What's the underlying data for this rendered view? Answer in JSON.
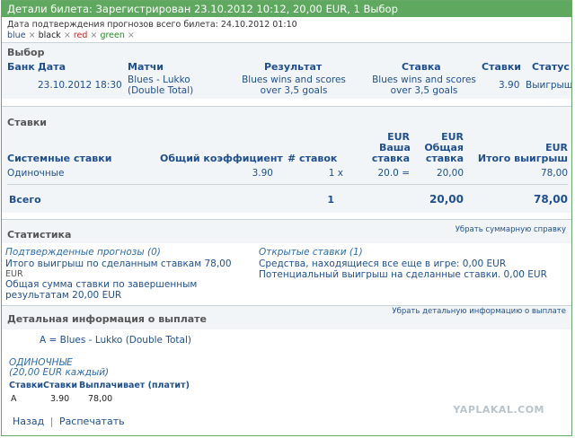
{
  "title": "Детали билета: Зарегистрирован 23.10.2012 10:12, 20,00 EUR, 1 Выбор",
  "confirm_date": "Дата подтверждения прогнозов всего билета: 24.10.2012 01:10",
  "colors": [
    {
      "label": "blue",
      "color": "#1f4f8f"
    },
    {
      "label": "black",
      "color": "#222222"
    },
    {
      "label": "red",
      "color": "#cc2222"
    },
    {
      "label": "green",
      "color": "#2a8a2a"
    }
  ],
  "x": "×",
  "selection": {
    "heading": "Выбор",
    "cols": {
      "bank": "Банк",
      "date": "Дата",
      "match": "Матчи",
      "result": "Результат",
      "bet": "Ставка",
      "stakes": "Ставки",
      "status": "Статус"
    },
    "row": {
      "date": "23.10.2012 18:30",
      "match_line1": "Blues - Lukko",
      "match_line2": "(Double Total)",
      "result_line1": "Blues wins and scores",
      "result_line2": "over 3,5 goals",
      "bet_line1": "Blues wins and scores",
      "bet_line2": "over 3,5 goals",
      "odds": "3.90",
      "status": "Выигрыш"
    }
  },
  "stakes": {
    "heading": "Ставки",
    "cols": {
      "system": "Системные ставки",
      "coef": "Общий коэффициент",
      "num": "# ставок",
      "your_cur": "EUR",
      "your_l1": "Ваша",
      "your_l2": "ставка",
      "total_cur": "EUR",
      "total_l1": "Общая",
      "total_l2": "ставка",
      "win_cur": "EUR",
      "win_l": "Итого выигрыш"
    },
    "row": {
      "type": "Одиночные",
      "coef": "3.90",
      "num": "1 x",
      "your": "20.0 =",
      "total": "20,00",
      "win": "78,00"
    },
    "total": {
      "label": "Всего",
      "num": "1",
      "total": "20,00",
      "win": "78,00"
    }
  },
  "stats": {
    "heading": "Статистика",
    "hide_link": "Убрать суммарную справку",
    "confirmed": "Подтвержденные прогнозы (0)",
    "win_line1": "Итого выигрыш по сделанным ставкам 78,00",
    "win_line2": "EUR",
    "sum_line1": "Общая сумма ставки по завершенным",
    "sum_line2": "результатам 20,00 EUR",
    "open": "Открытые ставки (1)",
    "in_game": "Средства, находящиеся все еще в игре: 0,00 EUR",
    "potential": "Потенциальный выигрыш на сделанные ставки. 0,00 EUR"
  },
  "payout": {
    "heading": "Детальная информация о выплате",
    "hide_link": "Убрать детальную информацию о выплате",
    "line": "A = Blues - Lukko (Double Total)",
    "singles": "ОДИНОЧНЫЕ",
    "each": "(20,00 EUR каждый)",
    "cols": {
      "c1": "Ставки",
      "c2": "Ставки",
      "c3": "Выплачивает (платит)"
    },
    "row": {
      "c1": "A",
      "c2": "3.90",
      "c3": "78,00"
    }
  },
  "footer": {
    "back": "Назад",
    "sep": "|",
    "print": "Распечатать"
  },
  "watermark": "YAPLAKAL.COM"
}
